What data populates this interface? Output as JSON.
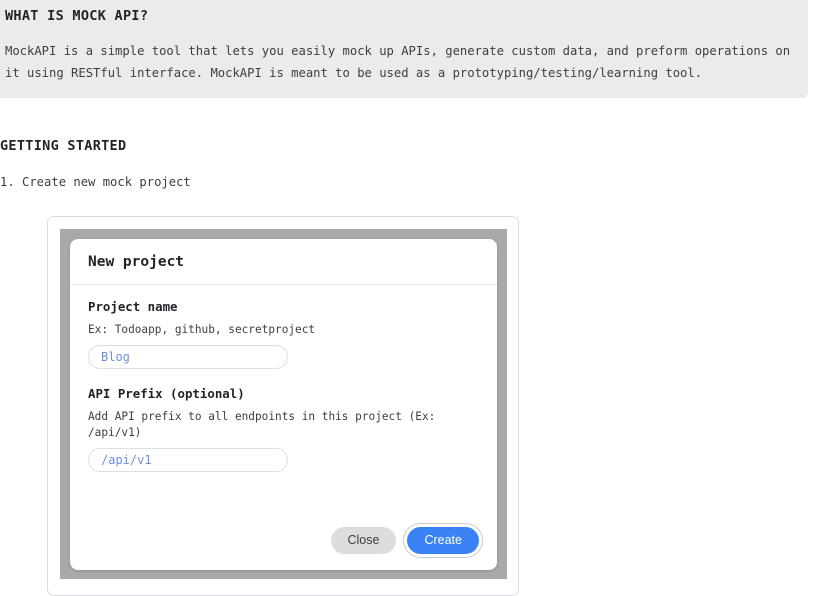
{
  "intro": {
    "heading": "WHAT IS MOCK API?",
    "paragraph": "MockAPI is a simple tool that lets you easily mock up APIs, generate custom data, and preform operations on it using RESTful interface. MockAPI is meant to be used as a prototyping/testing/learning tool."
  },
  "getting_started": {
    "heading": "GETTING STARTED",
    "step_1": "1. Create new mock project"
  },
  "modal": {
    "title": "New project",
    "fields": [
      {
        "label": "Project name",
        "hint": "Ex: Todoapp, github, secretproject",
        "value": "Blog",
        "placeholder": "Blog"
      },
      {
        "label": "API Prefix (optional)",
        "hint": "Add API prefix to all endpoints in this project (Ex: /api/v1)",
        "value": "/api/v1",
        "placeholder": "/api/v1"
      }
    ],
    "buttons": {
      "close": "Close",
      "create": "Create"
    }
  },
  "colors": {
    "banner_bg": "#ebebeb",
    "backdrop_gray": "#a9a9a9",
    "accent_blue": "#3b82f6",
    "input_text_blue": "#6e8fe0",
    "close_gray": "#dddddd"
  }
}
